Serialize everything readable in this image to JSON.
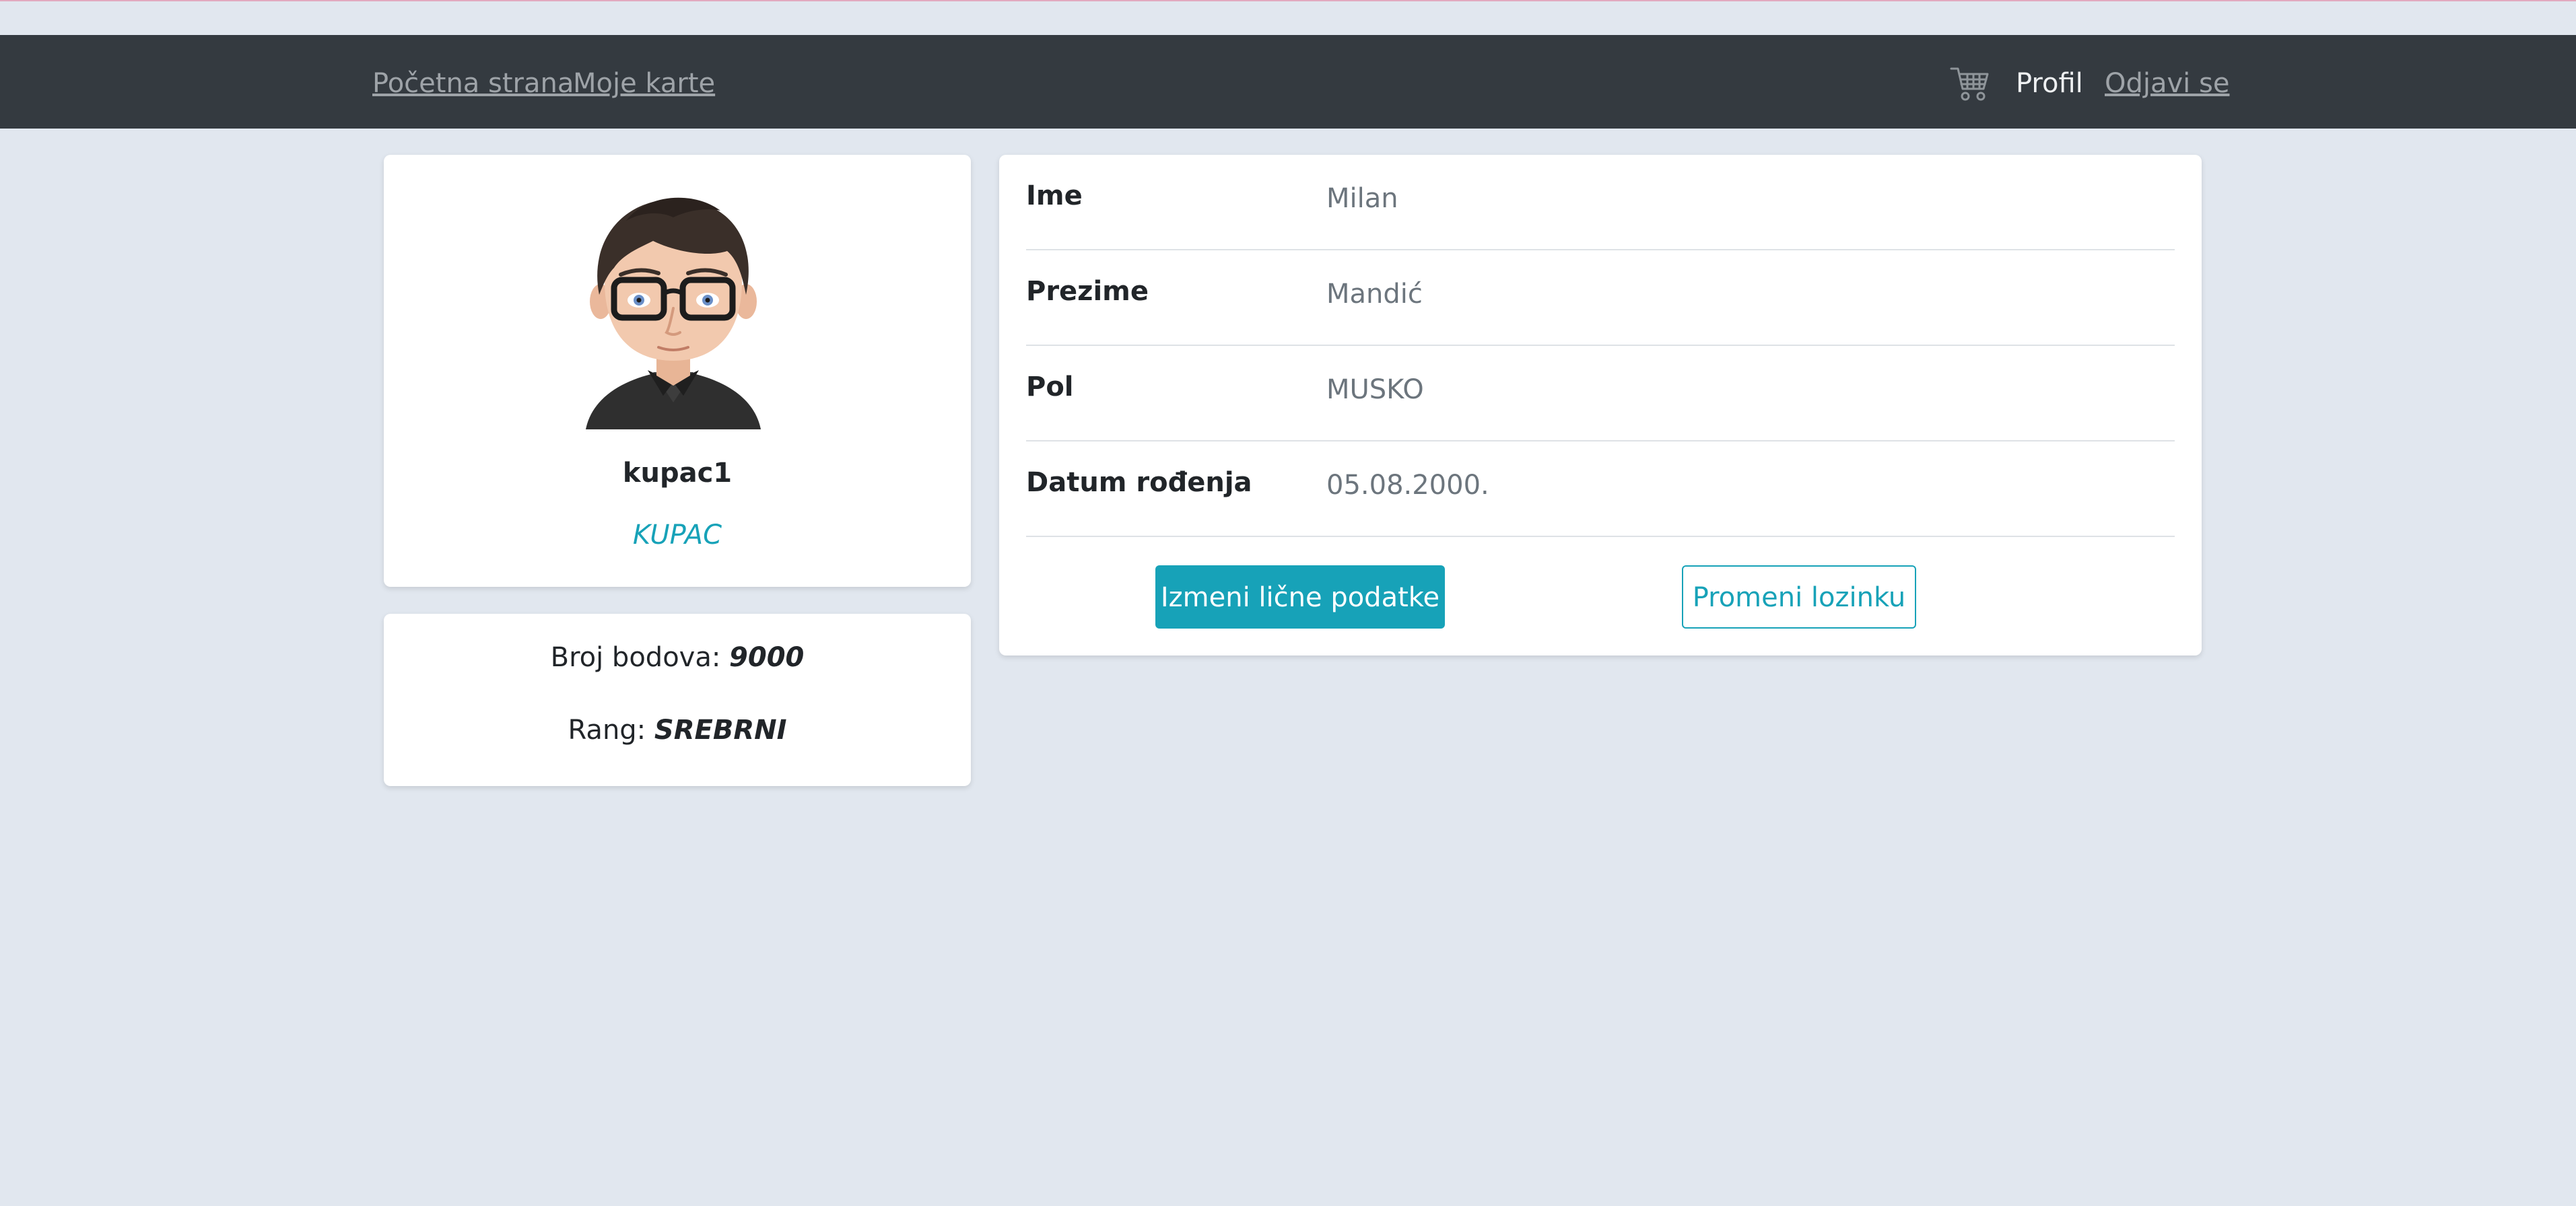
{
  "nav": {
    "home": "Početna strana",
    "my_tickets": "Moje karte",
    "profile": "Profil",
    "logout": "Odjavi se",
    "cart_icon": "shopping-cart-icon"
  },
  "profile_card": {
    "avatar_icon": "user-avatar",
    "username": "kupac1",
    "role": "KUPAC"
  },
  "stats": {
    "points_label": "Broj bodova:",
    "points_value": "9000",
    "rank_label": "Rang:",
    "rank_value": "SREBRNI"
  },
  "details": {
    "rows": [
      {
        "label": "Ime",
        "value": "Milan"
      },
      {
        "label": "Prezime",
        "value": "Mandić"
      },
      {
        "label": "Pol",
        "value": "MUSKO"
      },
      {
        "label": "Datum rođenja",
        "value": "05.08.2000."
      }
    ],
    "edit_button": "Izmeni lične podatke",
    "password_button": "Promeni lozinku"
  },
  "colors": {
    "navbar_bg": "#343a40",
    "page_bg": "#e1e7ef",
    "accent": "#17a2b8"
  }
}
